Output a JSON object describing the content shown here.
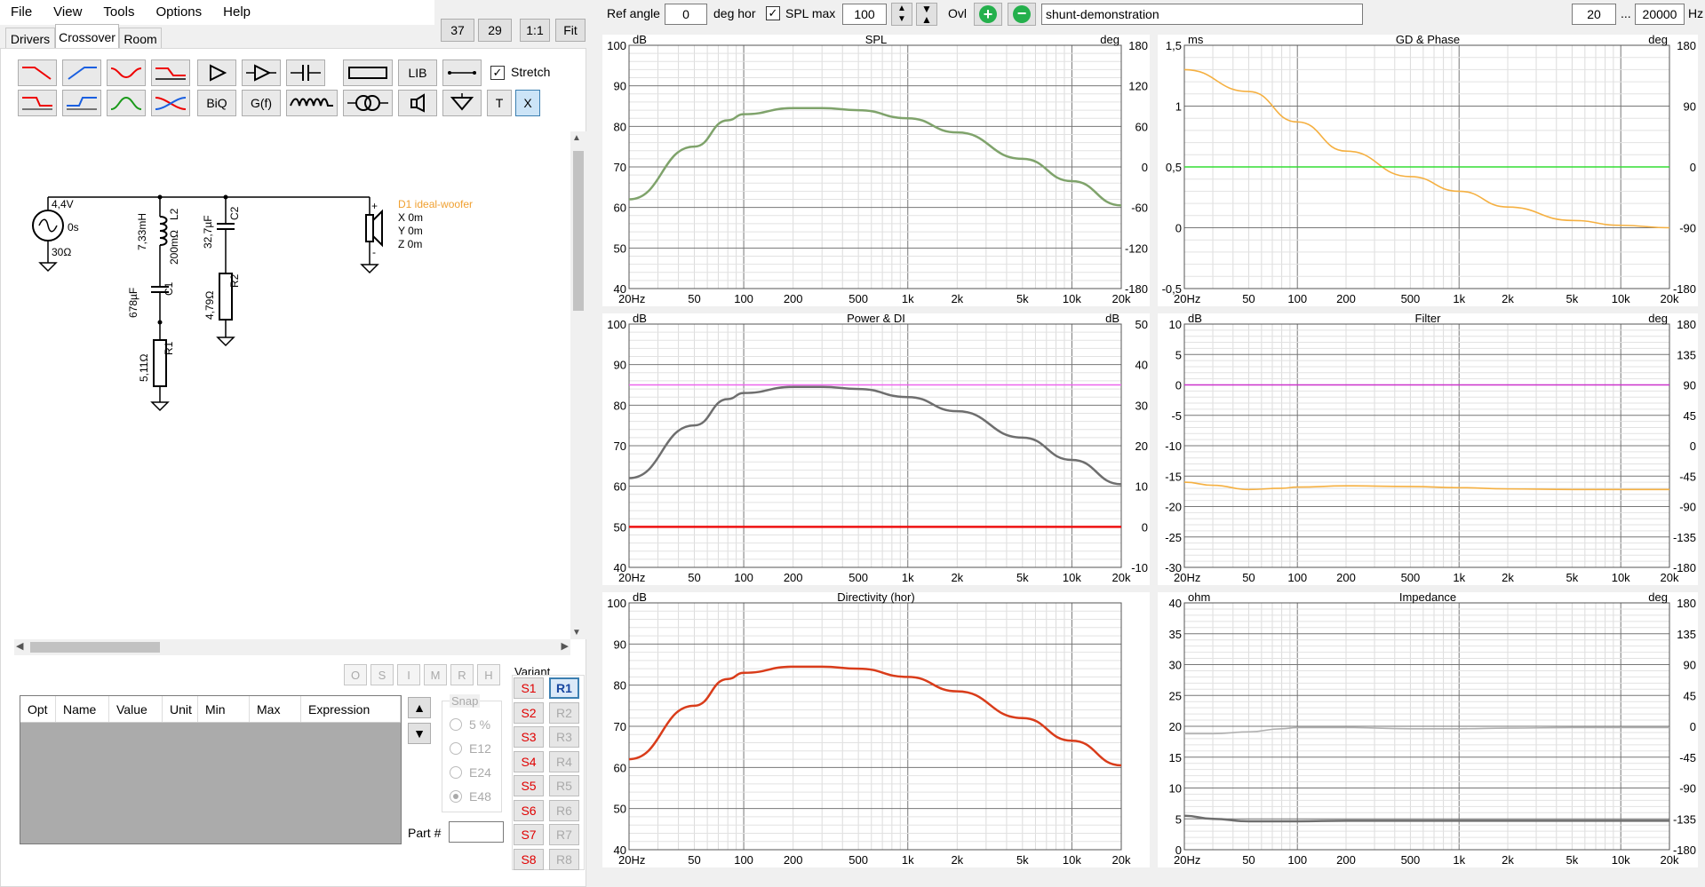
{
  "menu": [
    "File",
    "View",
    "Tools",
    "Options",
    "Help"
  ],
  "top_buttons": [
    "37",
    "29",
    "1:1",
    "Fit"
  ],
  "tabs": [
    "Drivers",
    "Crossover",
    "Room"
  ],
  "toolbar": {
    "lib": "LIB",
    "stretch": "Stretch",
    "biq": "BiQ",
    "gf": "G(f)",
    "t": "T",
    "x": "X"
  },
  "topbar": {
    "ref_angle_label": "Ref angle",
    "ref_angle_value": "0",
    "deg_hor": "deg hor",
    "spl_max_label": "SPL max",
    "spl_max_value": "100",
    "ovl": "Ovl",
    "project_name": "shunt-demonstration",
    "freq_from": "20",
    "ellipsis": "...",
    "freq_to": "20000",
    "hz": "Hz"
  },
  "circuit": {
    "source_v": "4,4V",
    "source_t": "0s",
    "source_r": "30Ω",
    "L2_value": "7,33mH",
    "L2_res": "200mΩ",
    "L2_name": "L2",
    "C1_value": "678µF",
    "C1_name": "C1",
    "R1_value": "5,11Ω",
    "R1_name": "R1",
    "C2_value": "32,7µF",
    "C2_name": "C2",
    "R2_value": "4,79Ω",
    "R2_name": "R2",
    "driver_name": "D1 ideal-woofer",
    "driver_x": "X 0m",
    "driver_y": "Y 0m",
    "driver_z": "Z 0m",
    "plus": "+",
    "minus": "-"
  },
  "opt_buttons": [
    "O",
    "S",
    "I",
    "M",
    "R",
    "H"
  ],
  "table_headers": [
    "Opt",
    "Name",
    "Value",
    "Unit",
    "Min",
    "Max",
    "Expression"
  ],
  "snap": {
    "label": "Snap",
    "options": [
      "5 %",
      "E12",
      "E24",
      "E48"
    ],
    "selected": "E48"
  },
  "variant": {
    "label": "Variant",
    "s": [
      "S1",
      "S2",
      "S3",
      "S4",
      "S5",
      "S6",
      "S7",
      "S8"
    ],
    "r": [
      "R1",
      "R2",
      "R3",
      "R4",
      "R5",
      "R6",
      "R7",
      "R8"
    ],
    "selected": "R1"
  },
  "part_label": "Part #",
  "x_ticks": [
    "20Hz",
    "50",
    "100",
    "200",
    "500",
    "1k",
    "2k",
    "5k",
    "10k",
    "20k"
  ],
  "charts": [
    {
      "title": "SPL",
      "left_unit": "dB",
      "right_unit": "deg",
      "left_ticks": [
        "100",
        "90",
        "80",
        "70",
        "60",
        "50",
        "40"
      ],
      "right_ticks": [
        "180",
        "120",
        "60",
        "0",
        "-60",
        "-120",
        "-180"
      ]
    },
    {
      "title": "GD & Phase",
      "left_unit": "ms",
      "right_unit": "deg",
      "left_ticks": [
        "1,5",
        "1",
        "0,5",
        "0",
        "-0,5"
      ],
      "right_ticks": [
        "180",
        "90",
        "0",
        "-90",
        "-180"
      ]
    },
    {
      "title": "Power & DI",
      "left_unit": "dB",
      "right_unit": "dB",
      "left_ticks": [
        "100",
        "90",
        "80",
        "70",
        "60",
        "50",
        "40"
      ],
      "right_ticks": [
        "50",
        "40",
        "30",
        "20",
        "10",
        "0",
        "-10"
      ]
    },
    {
      "title": "Filter",
      "left_unit": "dB",
      "right_unit": "deg",
      "left_ticks": [
        "10",
        "5",
        "0",
        "-5",
        "-10",
        "-15",
        "-20",
        "-25",
        "-30"
      ],
      "right_ticks": [
        "180",
        "135",
        "90",
        "45",
        "0",
        "-45",
        "-90",
        "-135",
        "-180"
      ]
    },
    {
      "title": "Directivity (hor)",
      "left_unit": "dB",
      "right_unit": "",
      "left_ticks": [
        "100",
        "90",
        "80",
        "70",
        "60",
        "50",
        "40"
      ],
      "right_ticks": []
    },
    {
      "title": "Impedance",
      "left_unit": "ohm",
      "right_unit": "deg",
      "left_ticks": [
        "40",
        "35",
        "30",
        "25",
        "20",
        "15",
        "10",
        "5",
        "0"
      ],
      "right_ticks": [
        "180",
        "135",
        "90",
        "45",
        "0",
        "-45",
        "-90",
        "-135",
        "-180"
      ]
    }
  ],
  "chart_data": [
    {
      "type": "line",
      "title": "SPL",
      "ylabel": "dB",
      "xlim": [
        20,
        20000
      ],
      "ylim": [
        40,
        100
      ],
      "x_scale": "log",
      "series": [
        {
          "color": "#7fa36b",
          "x": [
            20,
            50,
            80,
            100,
            200,
            300,
            500,
            1000,
            2000,
            5000,
            10000,
            20000
          ],
          "y": [
            62,
            75,
            81.5,
            83,
            84.5,
            84.5,
            84,
            82,
            78.5,
            72,
            66.5,
            60.5
          ]
        }
      ]
    },
    {
      "type": "line",
      "title": "GD & Phase",
      "ylabel": "ms",
      "xlim": [
        20,
        20000
      ],
      "ylim": [
        -0.5,
        1.5
      ],
      "x_scale": "log",
      "series": [
        {
          "color": "#f5b041",
          "x": [
            20,
            50,
            100,
            200,
            500,
            1000,
            2000,
            5000,
            10000,
            20000
          ],
          "y": [
            1.3,
            1.12,
            0.87,
            0.63,
            0.42,
            0.3,
            0.17,
            0.06,
            0.02,
            0
          ]
        },
        {
          "color": "#33dd33",
          "x": [
            20,
            20000
          ],
          "y": [
            0.5,
            0.5
          ]
        }
      ]
    },
    {
      "type": "line",
      "title": "Power & DI",
      "ylabel": "dB",
      "xlim": [
        20,
        20000
      ],
      "ylim": [
        40,
        100
      ],
      "x_scale": "log",
      "series": [
        {
          "color": "#6e6e6e",
          "x": [
            20,
            50,
            80,
            100,
            200,
            300,
            500,
            1000,
            2000,
            5000,
            10000,
            20000
          ],
          "y": [
            62,
            75,
            81.5,
            83,
            84.5,
            84.5,
            84,
            82,
            78.5,
            72,
            66.5,
            60.5
          ]
        },
        {
          "color": "#ee66ee",
          "x": [
            20,
            20000
          ],
          "y": [
            85,
            85
          ]
        },
        {
          "color": "#ee1111",
          "x": [
            20,
            20000
          ],
          "y": [
            50,
            50
          ]
        }
      ]
    },
    {
      "type": "line",
      "title": "Filter",
      "ylabel": "dB",
      "xlim": [
        20,
        20000
      ],
      "ylim": [
        -30,
        10
      ],
      "x_scale": "log",
      "series": [
        {
          "color": "#cc33cc",
          "x": [
            20,
            20000
          ],
          "y": [
            0,
            0
          ]
        },
        {
          "color": "#f5b041",
          "x": [
            20,
            30,
            50,
            80,
            100,
            200,
            500,
            1000,
            2000,
            5000,
            10000,
            20000
          ],
          "y": [
            -16,
            -16.5,
            -17.2,
            -17,
            -16.8,
            -16.6,
            -16.7,
            -16.9,
            -17.1,
            -17.2,
            -17.2,
            -17.2
          ]
        }
      ]
    },
    {
      "type": "line",
      "title": "Directivity (hor)",
      "ylabel": "dB",
      "xlim": [
        20,
        20000
      ],
      "ylim": [
        40,
        100
      ],
      "x_scale": "log",
      "series": [
        {
          "color": "#d93c1a",
          "x": [
            20,
            50,
            80,
            100,
            200,
            300,
            500,
            1000,
            2000,
            5000,
            10000,
            20000
          ],
          "y": [
            62,
            75,
            81.5,
            83,
            84.5,
            84.5,
            84,
            82,
            78.5,
            72,
            66.5,
            60.5
          ]
        }
      ]
    },
    {
      "type": "line",
      "title": "Impedance",
      "ylabel": "ohm",
      "xlim": [
        20,
        20000
      ],
      "ylim": [
        0,
        40
      ],
      "x_scale": "log",
      "series": [
        {
          "color": "#b0b0b0",
          "x": [
            20,
            30,
            50,
            80,
            100,
            200,
            500,
            1000,
            2000,
            5000,
            10000,
            20000
          ],
          "y": [
            18.8,
            18.8,
            19.1,
            19.6,
            19.8,
            19.8,
            19.6,
            19.6,
            19.7,
            19.8,
            19.8,
            19.8
          ]
        },
        {
          "color": "#6e6e6e",
          "x": [
            20,
            30,
            50,
            80,
            100,
            200,
            500,
            1000,
            2000,
            5000,
            10000,
            20000
          ],
          "y": [
            5.5,
            5,
            4.6,
            4.6,
            4.6,
            4.7,
            4.7,
            4.7,
            4.7,
            4.7,
            4.7,
            4.7
          ]
        }
      ]
    }
  ]
}
